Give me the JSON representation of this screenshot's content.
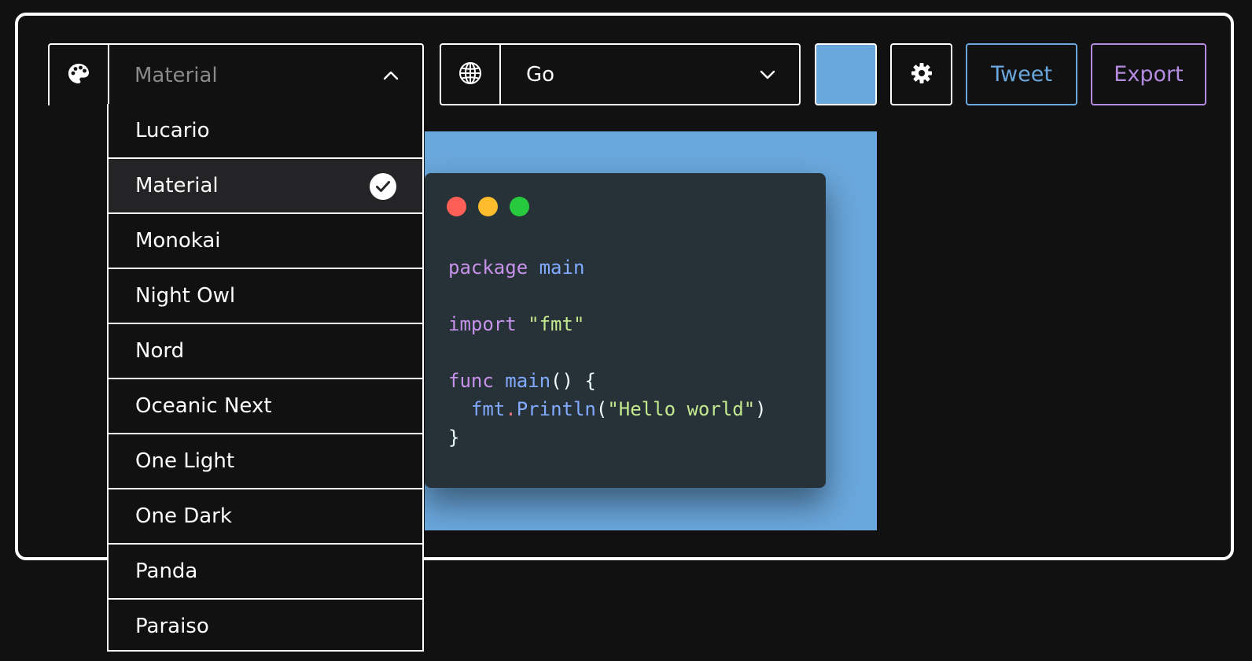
{
  "toolbar": {
    "theme_select": {
      "value": "Material"
    },
    "language_select": {
      "value": "Go"
    },
    "background_color": "#6aa7dc",
    "tweet_label": "Tweet",
    "export_label": "Export"
  },
  "theme_dropdown": {
    "items": [
      {
        "label": "Lucario",
        "selected": false
      },
      {
        "label": "Material",
        "selected": true
      },
      {
        "label": "Monokai",
        "selected": false
      },
      {
        "label": "Night Owl",
        "selected": false
      },
      {
        "label": "Nord",
        "selected": false
      },
      {
        "label": "Oceanic Next",
        "selected": false
      },
      {
        "label": "One Light",
        "selected": false
      },
      {
        "label": "One Dark",
        "selected": false
      },
      {
        "label": "Panda",
        "selected": false
      },
      {
        "label": "Paraiso",
        "selected": false
      }
    ]
  },
  "editor": {
    "window_controls": [
      "#ff5f56",
      "#ffbd2e",
      "#27c93f"
    ],
    "code_lines": [
      "package main",
      "",
      "import \"fmt\"",
      "",
      "func main() {",
      "  fmt.Println(\"Hello world\")",
      "}"
    ]
  },
  "icons": {
    "theme": "palette-icon",
    "language": "globe-icon",
    "settings": "gear-icon",
    "theme_chevron": "chevron-up-icon",
    "language_chevron": "chevron-down-icon",
    "selected": "check-circle-icon"
  }
}
